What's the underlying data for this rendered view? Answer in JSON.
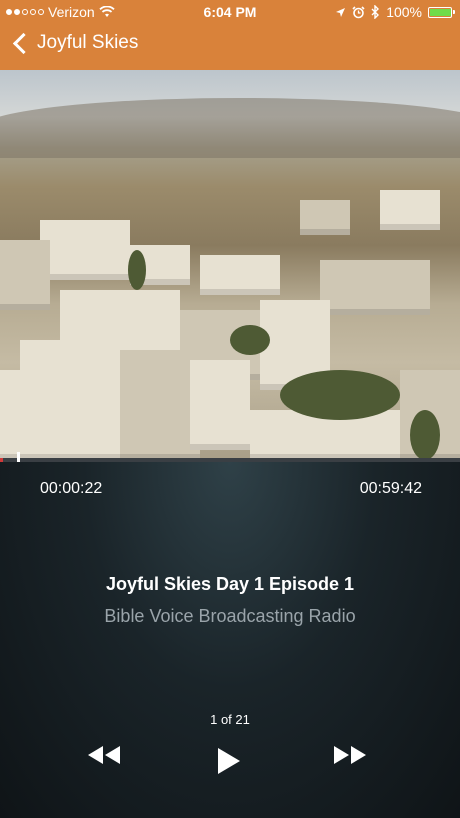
{
  "status_bar": {
    "carrier": "Verizon",
    "time": "6:04 PM",
    "battery": "100%",
    "battery_level": 1.0,
    "signal_bars": 2
  },
  "nav": {
    "back_label": "Joyful Skies"
  },
  "player": {
    "elapsed": "00:00:22",
    "duration": "00:59:42",
    "progress": 0.006,
    "title": "Joyful Skies Day 1 Episode 1",
    "station": "Bible Voice Broadcasting Radio",
    "position": "1 of 21"
  },
  "colors": {
    "nav_bg": "#d9823a",
    "progress_fill": "#d03a3a",
    "battery_fill": "#6fdc4a"
  },
  "icons": [
    "signal-dots-icon",
    "wifi-icon",
    "location-arrow-icon",
    "alarm-icon",
    "bluetooth-icon",
    "battery-icon",
    "chevron-left-icon",
    "rewind-icon",
    "play-icon",
    "fast-forward-icon"
  ]
}
